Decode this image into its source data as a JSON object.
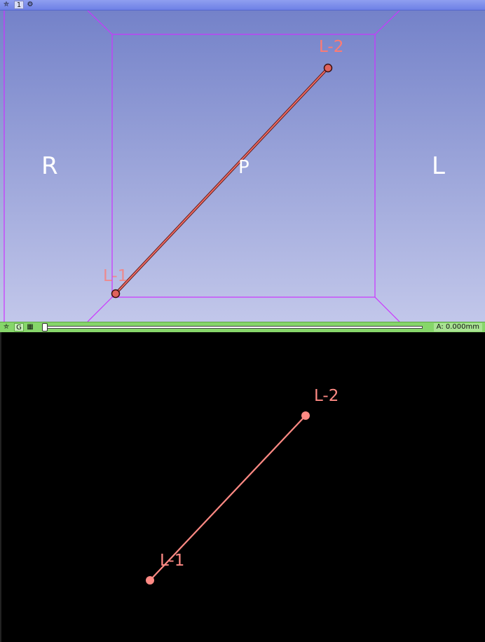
{
  "view3d": {
    "view_number": "1",
    "icons": [
      "pin-icon",
      "gear-icon"
    ],
    "orientation": {
      "left": "R",
      "right": "L",
      "center": "P"
    },
    "colors": {
      "bg_top": "#7482c9",
      "bg_bottom": "#c2c7ea",
      "box": "#cc33ff",
      "markup": "#ff7a72"
    }
  },
  "markups": {
    "line_points": [
      "L-1",
      "L-2"
    ]
  },
  "slice_controller": {
    "g_label": "G",
    "offset_text": "A: 0.000mm",
    "slider_value": 0,
    "color": "#86d66a"
  },
  "slice_view": {
    "colors": {
      "bg": "#000000",
      "markup": "#ff8a84"
    }
  }
}
